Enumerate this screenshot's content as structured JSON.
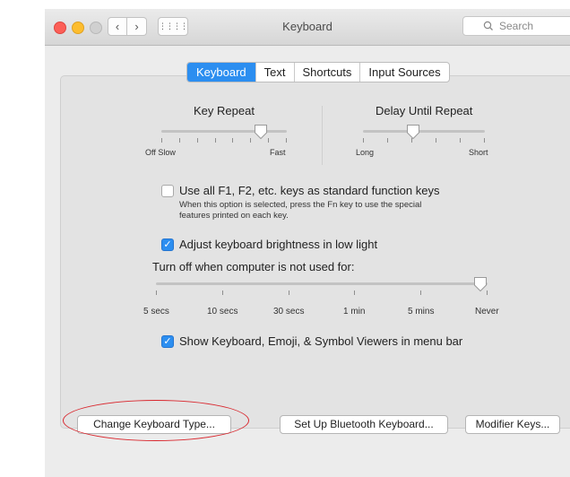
{
  "window": {
    "title": "Keyboard",
    "nav_back": "‹",
    "nav_forward": "›",
    "grid": "⋮⋮⋮⋮",
    "search_icon": "search-icon",
    "search_placeholder": "Search"
  },
  "tabs": [
    {
      "label": "Keyboard",
      "active": true
    },
    {
      "label": "Text",
      "active": false
    },
    {
      "label": "Shortcuts",
      "active": false
    },
    {
      "label": "Input Sources",
      "active": false
    }
  ],
  "key_repeat": {
    "title": "Key Repeat",
    "min_label": "Off Slow",
    "max_label": "Fast",
    "value_fraction": 0.83
  },
  "delay_until_repeat": {
    "title": "Delay Until Repeat",
    "min_label": "Long",
    "max_label": "Short",
    "value_fraction": 0.4
  },
  "function_keys": {
    "checked": false,
    "label": "Use all F1, F2, etc. keys as standard function keys",
    "note_line1": "When this option is selected, press the Fn key to use the special",
    "note_line2": "features printed on each key."
  },
  "brightness": {
    "checked": true,
    "check_mark": "✓",
    "label": "Adjust keyboard brightness in low light"
  },
  "turn_off": {
    "label": "Turn off when computer is not used for:",
    "ticks": [
      "5 secs",
      "10 secs",
      "30 secs",
      "1 min",
      "5 mins",
      "Never"
    ],
    "value_fraction": 1.0
  },
  "viewers": {
    "checked": true,
    "check_mark": "✓",
    "label": "Show Keyboard, Emoji, & Symbol Viewers in menu bar"
  },
  "buttons": {
    "change_type": "Change Keyboard Type...",
    "bluetooth": "Set Up Bluetooth Keyboard...",
    "modifier": "Modifier Keys..."
  },
  "colors": {
    "accent": "#2c8ef0",
    "annotation": "#d9272e"
  }
}
